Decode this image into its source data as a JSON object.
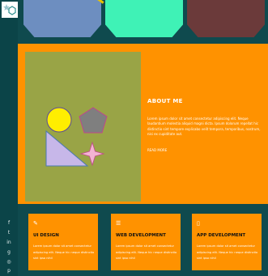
{
  "sidebar": {
    "social_icons": [
      {
        "name": "facebook-icon",
        "glyph": "f"
      },
      {
        "name": "twitter-icon",
        "glyph": "t"
      },
      {
        "name": "linkedin-icon",
        "glyph": "in"
      },
      {
        "name": "google-plus-icon",
        "glyph": "g"
      },
      {
        "name": "instagram-icon",
        "glyph": "◎"
      },
      {
        "name": "pinterest-icon",
        "glyph": "p"
      }
    ]
  },
  "about": {
    "title": "ABOUT ME",
    "body": "Lorem ipsum dolor sit amet consectetur adipiscing elit. Neque laudantium molestia aliquid magni dicta. Ipsum dolorum repellat hic distinctio sint tempore explicabo velit tempora, temporibus, nostrum, nisi ex cupiditate aut.",
    "read_more": "READ MORE"
  },
  "services": [
    {
      "icon": "pencil-icon",
      "glyph": "✎",
      "title": "UI DESIGN",
      "body": "Lorem ipsum dolor sit amet consectetur adipiscing elit. Neque hic neque distinctio sint ipso nihil"
    },
    {
      "icon": "list-icon",
      "glyph": "☰",
      "title": "WEB DEVELOPMENT",
      "body": "Lorem ipsum dolor sit amet consectetur adipiscing elit. Neque hic neque distinctio sint ipso nihil"
    },
    {
      "icon": "phone-icon",
      "glyph": "▯",
      "title": "APP DEVELOPMENT",
      "body": "Lorem ipsum dolor sit amet consectetur adipiscing elit. Neque hic neque distinctio sint ipso nihil"
    }
  ],
  "colors": {
    "background": "#0f4a4e",
    "accent": "#ff9200",
    "art_background": "#99a446",
    "tile_blue": "#6d8ec0",
    "tile_green": "#3ff2b6",
    "tile_maroon": "#6b3a3a"
  }
}
